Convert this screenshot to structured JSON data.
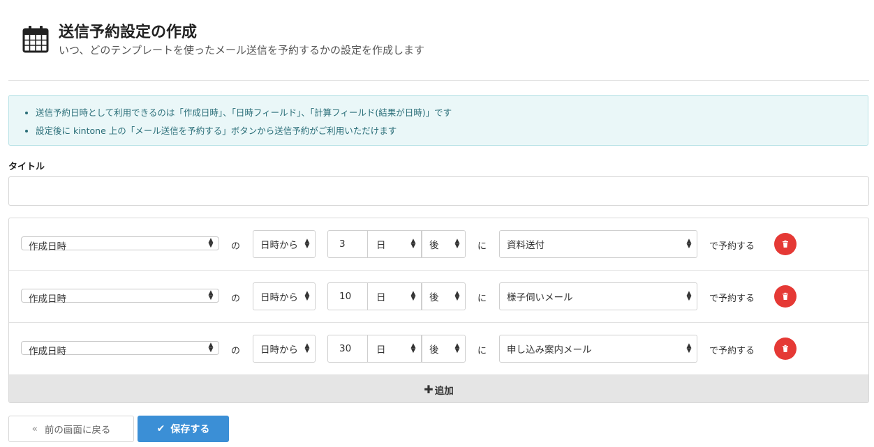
{
  "header": {
    "title": "送信予約設定の作成",
    "subtitle": "いつ、どのテンプレートを使ったメール送信を予約するかの設定を作成します",
    "icon": "calendar-icon"
  },
  "info": {
    "items": [
      "送信予約日時として利用できるのは「作成日時」、「日時フィールド」、「計算フィールド(結果が日時)」です",
      "設定後に kintone 上の「メール送信を予約する」ボタンから送信予約がご利用いただけます"
    ]
  },
  "title_field": {
    "label": "タイトル",
    "value": "",
    "placeholder": ""
  },
  "rules": [
    {
      "field": "作成日時",
      "no": "の",
      "base": "日時から",
      "amount": "3",
      "unit": "日",
      "direction": "後",
      "ni": "に",
      "template": "資料送付",
      "suffix": "で予約する"
    },
    {
      "field": "作成日時",
      "no": "の",
      "base": "日時から",
      "amount": "10",
      "unit": "日",
      "direction": "後",
      "ni": "に",
      "template": "様子伺いメール",
      "suffix": "で予約する"
    },
    {
      "field": "作成日時",
      "no": "の",
      "base": "日時から",
      "amount": "30",
      "unit": "日",
      "direction": "後",
      "ni": "に",
      "template": "申し込み案内メール",
      "suffix": "で予約する"
    }
  ],
  "add_label": "追加",
  "buttons": {
    "back": "前の画面に戻る",
    "save": "保存する"
  },
  "colors": {
    "info_bg": "#eaf7f8",
    "info_text": "#2a6e78",
    "delete": "#e53935",
    "primary": "#3b8fd6"
  }
}
